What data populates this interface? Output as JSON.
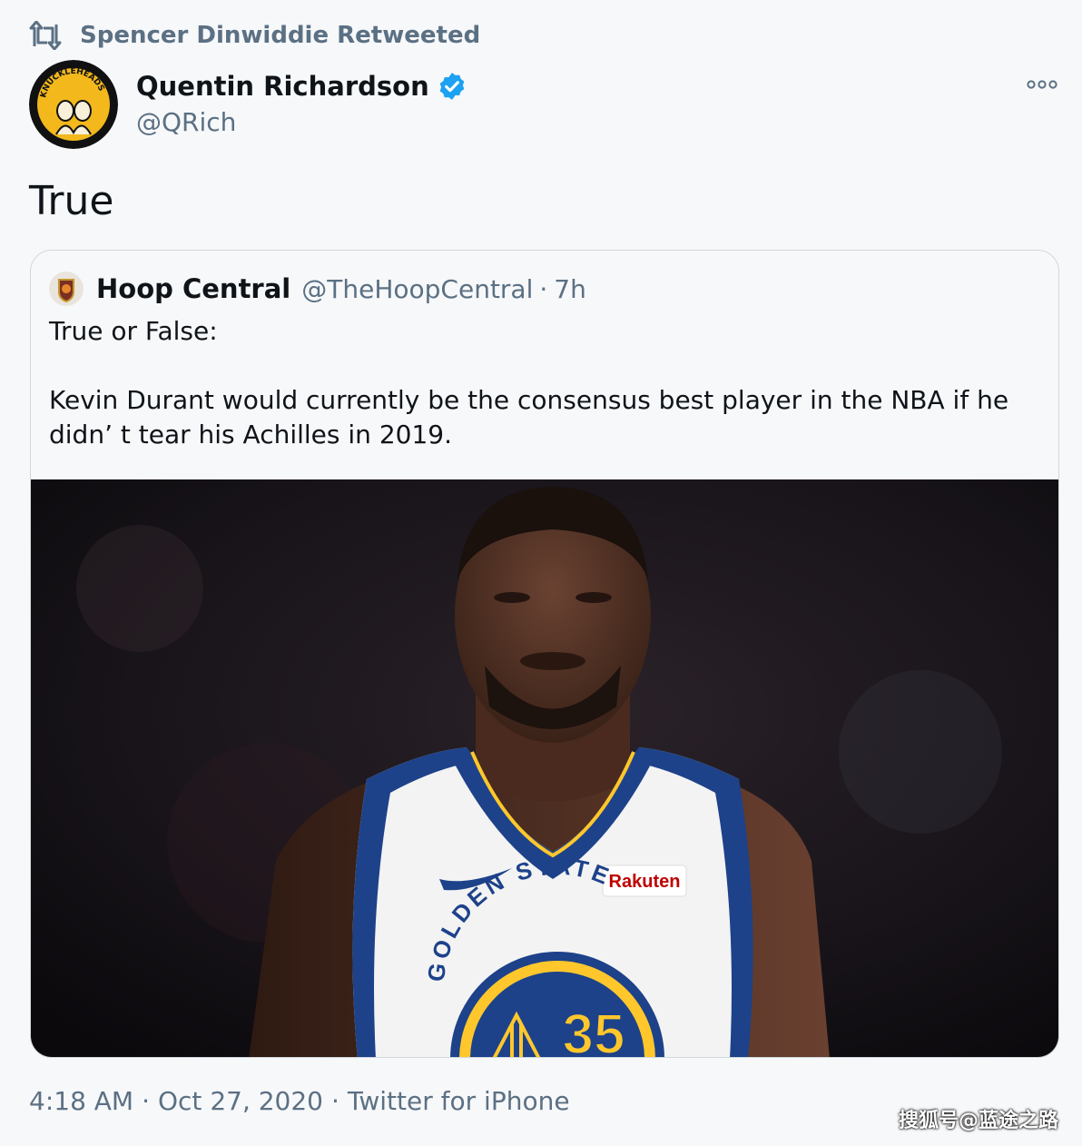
{
  "retweet": {
    "label": "Spencer Dinwiddie Retweeted",
    "icon": "retweet-icon"
  },
  "author": {
    "name": "Quentin Richardson",
    "handle": "@QRich",
    "verified": true,
    "avatar_text": "KNUCKLEHEADS"
  },
  "more_icon": "more-options-icon",
  "tweet": {
    "text": "True"
  },
  "quote": {
    "name": "Hoop Central",
    "handle": "@TheHoopCentral",
    "separator": "·",
    "time": "7h",
    "line1": "True or False:",
    "line2": "Kevin Durant would currently be the consensus best player in the NBA if he didn’ t tear his Achilles in 2019.",
    "image": {
      "sponsor": "Rakuten",
      "team_text": "GOLDEN STATE",
      "jersey_number": "35"
    }
  },
  "meta": {
    "time": "4:18 AM",
    "date": "Oct 27, 2020",
    "source": "Twitter for iPhone",
    "separator": "·"
  },
  "watermark": "搜狐号@蓝途之路",
  "colors": {
    "verified": "#1da1f2",
    "secondary_text": "#5b7083",
    "jersey_blue": "#1d428a",
    "jersey_gold": "#ffc72c"
  }
}
